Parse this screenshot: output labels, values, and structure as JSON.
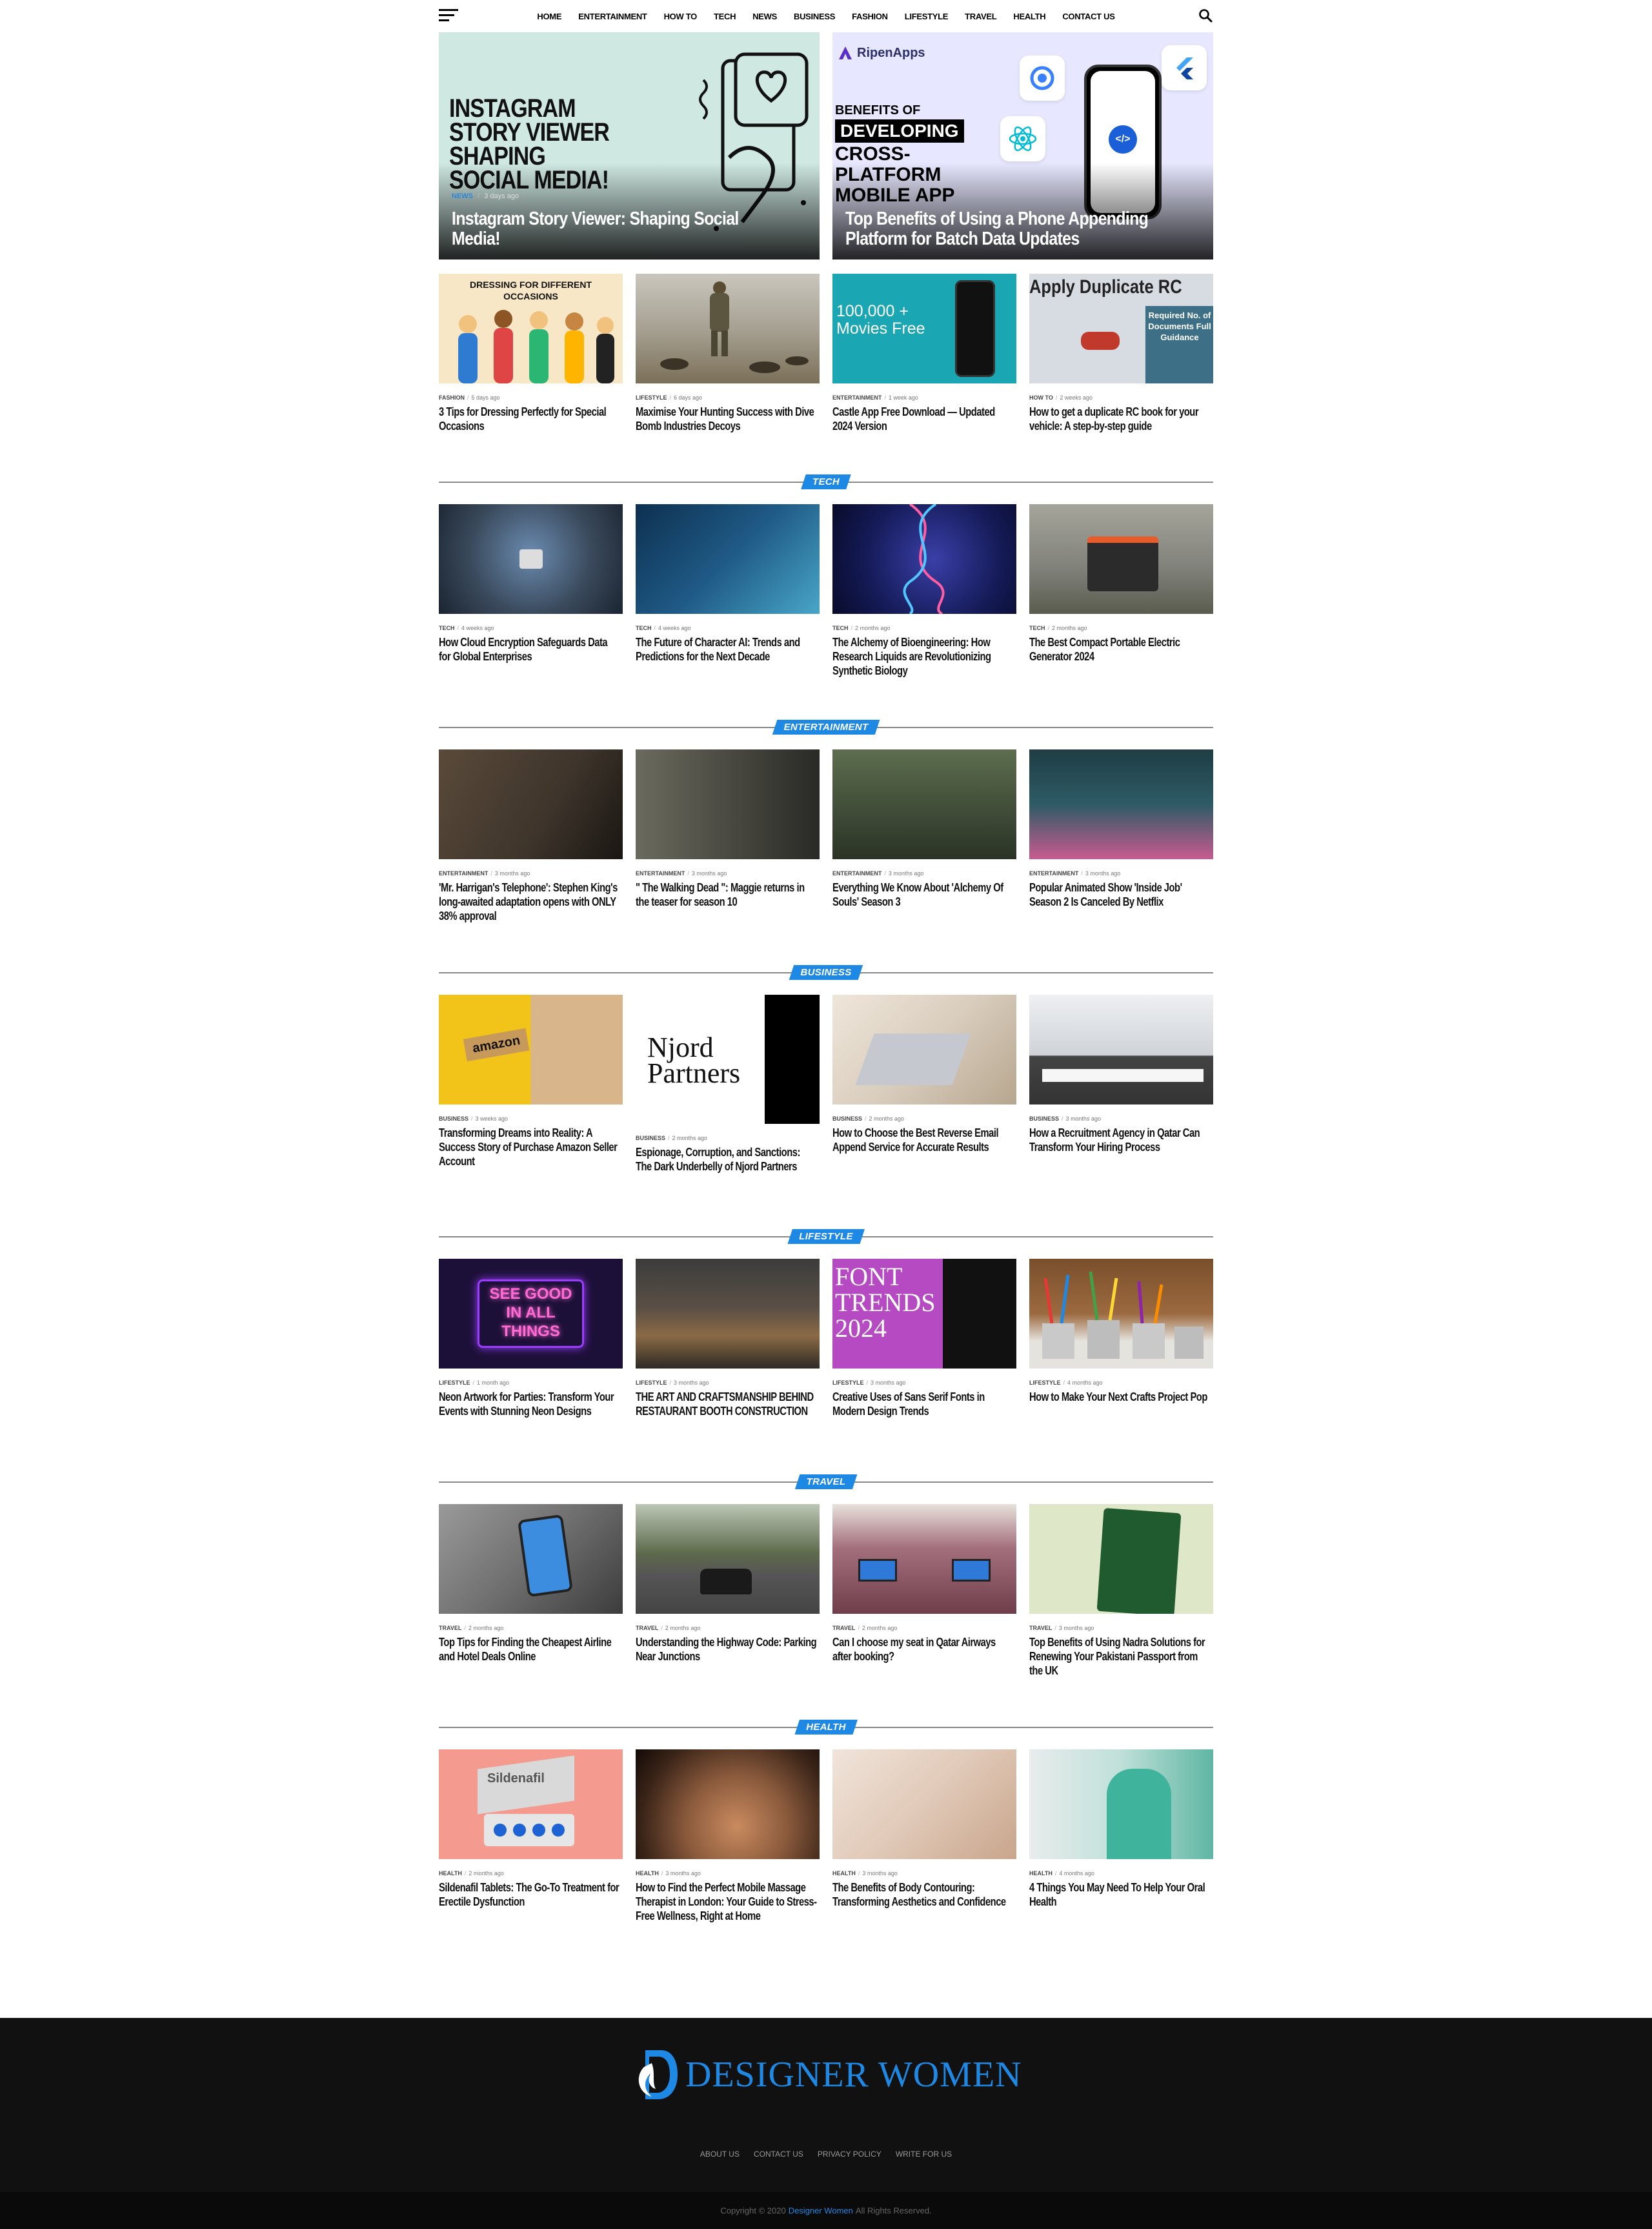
{
  "nav": {
    "items": [
      "HOME",
      "ENTERTAINMENT",
      "HOW TO",
      "TECH",
      "NEWS",
      "BUSINESS",
      "FASHION",
      "LIFESTYLE",
      "TRAVEL",
      "HEALTH",
      "CONTACT US"
    ]
  },
  "featured": [
    {
      "category": "NEWS",
      "time": "3 days ago",
      "title": "Instagram Story Viewer: Shaping Social Media!",
      "image_text": "INSTAGRAM STORY VIEWER SHAPING SOCIAL MEDIA!"
    },
    {
      "category": "",
      "time": "",
      "title": "Top Benefits of Using a Phone Appending Platform for Batch Data Updates",
      "brand": "RipenApps",
      "image_line1": "BENEFITS OF",
      "image_line2": "DEVELOPING",
      "image_line3": "CROSS-PLATFORM MOBILE APP"
    }
  ],
  "latest": [
    {
      "category": "FASHION",
      "time": "5 days ago",
      "title": "3 Tips for Dressing Perfectly for Special Occasions",
      "image_text": "DRESSING FOR DIFFERENT OCCASIONS",
      "bg": "#f7e7c6"
    },
    {
      "category": "LIFESTYLE",
      "time": "6 days ago",
      "title": "Maximise Your Hunting Success with Dive Bomb Industries Decoys",
      "bg": "#8f8a7d"
    },
    {
      "category": "ENTERTAINMENT",
      "time": "1 week ago",
      "title": "Castle App Free Download — Updated 2024 Version",
      "image_text": "100,000 + Movies Free",
      "bg": "#1aa6b3"
    },
    {
      "category": "HOW TO",
      "time": "2 weeks ago",
      "title": "How to get a duplicate RC book for your vehicle: A step-by-step guide",
      "image_text": "Apply Duplicate RC",
      "image_text2": "Required No. of Documents Full Guidance",
      "bg": "#d7dce3"
    }
  ],
  "sections": [
    {
      "label": "TECH",
      "items": [
        {
          "category": "TECH",
          "time": "4 weeks ago",
          "title": "How Cloud Encryption Safeguards Data for Global Enterprises",
          "bg": "#3a4a5c"
        },
        {
          "category": "TECH",
          "time": "4 weeks ago",
          "title": "The Future of Character AI: Trends and Predictions for the Next Decade",
          "bg": "#1f5a86"
        },
        {
          "category": "TECH",
          "time": "2 months ago",
          "title": "The Alchemy of Bioengineering: How Research Liquids are Revolutionizing Synthetic Biology",
          "bg": "#141a55"
        },
        {
          "category": "TECH",
          "time": "2 months ago",
          "title": "The Best Compact Portable Electric Generator 2024",
          "bg": "#7f8079"
        }
      ]
    },
    {
      "label": "ENTERTAINMENT",
      "items": [
        {
          "category": "ENTERTAINMENT",
          "time": "3 months ago",
          "title": "'Mr. Harrigan's Telephone': Stephen King's long-awaited adaptation opens with ONLY 38% approval",
          "bg": "#3d342b"
        },
        {
          "category": "ENTERTAINMENT",
          "time": "3 months ago",
          "title": "\" The Walking Dead \": Maggie returns in the teaser for season 10",
          "bg": "#4a4a42"
        },
        {
          "category": "ENTERTAINMENT",
          "time": "3 months ago",
          "title": "Everything We Know About 'Alchemy Of Souls' Season 3",
          "bg": "#3e4a36"
        },
        {
          "category": "ENTERTAINMENT",
          "time": "3 months ago",
          "title": "Popular Animated Show 'Inside Job' Season 2 Is Canceled By Netflix",
          "bg": "#2d5b66"
        }
      ]
    },
    {
      "label": "BUSINESS",
      "items": [
        {
          "category": "BUSINESS",
          "time": "3 weeks ago",
          "title": "Transforming Dreams into Reality: A Success Story of Purchase Amazon Seller Account",
          "image_text": "amazon",
          "bg": "#f2c318"
        },
        {
          "category": "BUSINESS",
          "time": "2 months ago",
          "title": "Espionage, Corruption, and Sanctions: The Dark Underbelly of Njord Partners",
          "image_text": "Njord Partners",
          "bg": "#ffffff"
        },
        {
          "category": "BUSINESS",
          "time": "2 months ago",
          "title": "How to Choose the Best Reverse Email Append Service for Accurate Results",
          "bg": "#d9cdbd"
        },
        {
          "category": "BUSINESS",
          "time": "3 months ago",
          "title": "How a Recruitment Agency in Qatar Can Transform Your Hiring Process",
          "bg": "#cfd3d8"
        }
      ]
    },
    {
      "label": "LIFESTYLE",
      "items": [
        {
          "category": "LIFESTYLE",
          "time": "1 month ago",
          "title": "Neon Artwork for Parties: Transform Your Events with Stunning Neon Designs",
          "image_text": "SEE GOOD IN ALL THINGS",
          "bg": "#1c1038"
        },
        {
          "category": "LIFESTYLE",
          "time": "3 months ago",
          "title": "THE ART AND CRAFTSMANSHIP BEHIND RESTAURANT BOOTH CONSTRUCTION",
          "bg": "#5a4f45"
        },
        {
          "category": "LIFESTYLE",
          "time": "3 months ago",
          "title": "Creative Uses of Sans Serif Fonts in Modern Design Trends",
          "image_text": "FONT TRENDS 2024",
          "bg": "#b64ac2"
        },
        {
          "category": "LIFESTYLE",
          "time": "4 months ago",
          "title": "How to Make Your Next Crafts Project Pop",
          "bg": "#9c6a3f"
        }
      ]
    },
    {
      "label": "TRAVEL",
      "items": [
        {
          "category": "TRAVEL",
          "time": "2 months ago",
          "title": "Top Tips for Finding the Cheapest Airline and Hotel Deals Online",
          "bg": "#6f6f6f"
        },
        {
          "category": "TRAVEL",
          "time": "2 months ago",
          "title": "Understanding the Highway Code: Parking Near Junctions",
          "bg": "#5d6a4c"
        },
        {
          "category": "TRAVEL",
          "time": "2 months ago",
          "title": "Can I choose my seat in Qatar Airways after booking?",
          "bg": "#a46f7c"
        },
        {
          "category": "TRAVEL",
          "time": "3 months ago",
          "title": "Top Benefits of Using Nadra Solutions for Renewing Your Pakistani Passport from the UK",
          "bg": "#dfe7c9"
        }
      ]
    },
    {
      "label": "HEALTH",
      "items": [
        {
          "category": "HEALTH",
          "time": "2 months ago",
          "title": "Sildenafil Tablets: The Go-To Treatment for Erectile Dysfunction",
          "image_text": "Sildenafil",
          "bg": "#f59a8f"
        },
        {
          "category": "HEALTH",
          "time": "3 months ago",
          "title": "How to Find the Perfect Mobile Massage Therapist in London: Your Guide to Stress-Free Wellness, Right at Home",
          "bg": "#3a2418"
        },
        {
          "category": "HEALTH",
          "time": "3 months ago",
          "title": "The Benefits of Body Contouring: Transforming Aesthetics and Confidence",
          "bg": "#e0c9b8"
        },
        {
          "category": "HEALTH",
          "time": "4 months ago",
          "title": "4 Things You May Need To Help Your Oral Health",
          "bg": "#bfe0d9"
        }
      ]
    }
  ],
  "footer": {
    "logo_text": "DESIGNER WOMEN",
    "links": [
      "ABOUT US",
      "CONTACT US",
      "PRIVACY POLICY",
      "WRITE FOR US"
    ],
    "copyright_prefix": "Copyright © 2020",
    "copyright_brand": "Designer Women",
    "copyright_suffix": "All Rights Reserved."
  },
  "colors": {
    "accent": "#1e88e5",
    "footer_bg": "#111111"
  }
}
